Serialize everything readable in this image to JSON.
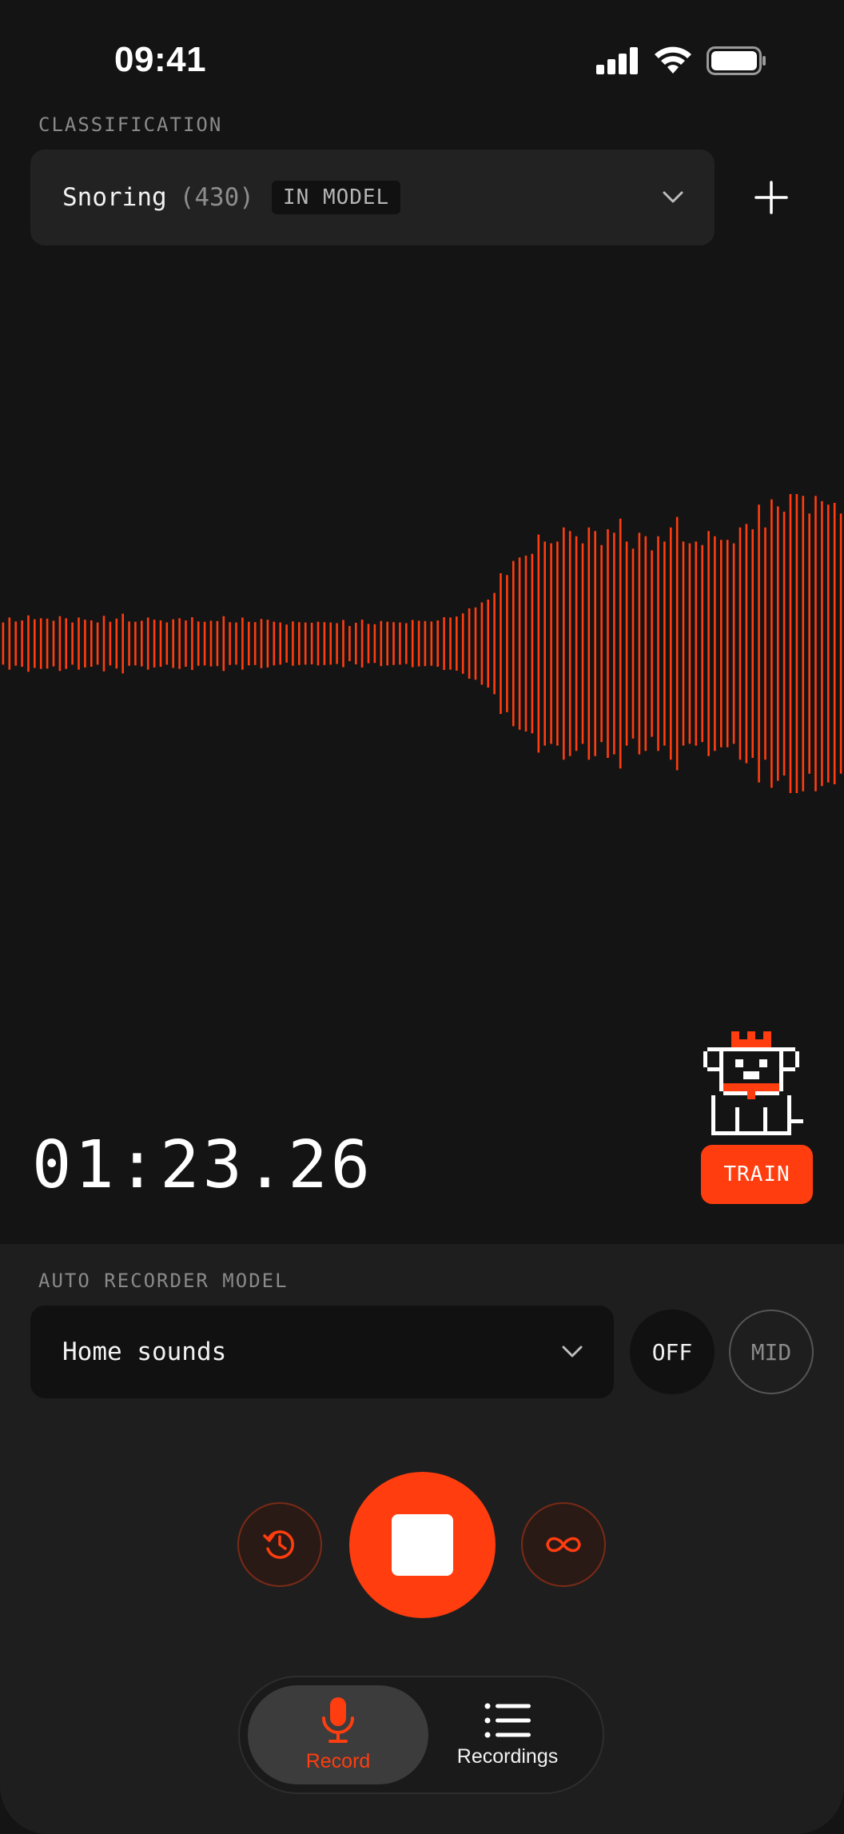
{
  "status_bar": {
    "time": "09:41"
  },
  "classification": {
    "label": "CLASSIFICATION",
    "name": "Snoring",
    "count": "(430)",
    "badge": "IN MODEL"
  },
  "timer": "01:23.26",
  "train_label": "TRAIN",
  "auto_recorder": {
    "label": "AUTO RECORDER MODEL",
    "model": "Home sounds",
    "toggle_off": "OFF",
    "toggle_mid": "MID"
  },
  "tabs": [
    {
      "label": "Record",
      "icon": "microphone-icon",
      "active": true
    },
    {
      "label": "Recordings",
      "icon": "list-icon",
      "active": false
    }
  ],
  "colors": {
    "accent": "#ff3d0f",
    "background": "#141415",
    "panel": "#1e1e1f"
  },
  "waveform_amplitudes": [
    0.12,
    0.14,
    0.11,
    0.13,
    0.15,
    0.12,
    0.14,
    0.13,
    0.11,
    0.15,
    0.13,
    0.12,
    0.14,
    0.12,
    0.13,
    0.11,
    0.14,
    0.12,
    0.13,
    0.15,
    0.12,
    0.11,
    0.13,
    0.14,
    0.12,
    0.13,
    0.11,
    0.12,
    0.14,
    0.12,
    0.13,
    0.12,
    0.11,
    0.13,
    0.12,
    0.14,
    0.12,
    0.11,
    0.13,
    0.12,
    0.11,
    0.12,
    0.13,
    0.11,
    0.12,
    0.1,
    0.11,
    0.12,
    0.11,
    0.1,
    0.12,
    0.11,
    0.1,
    0.11,
    0.12,
    0.1,
    0.11,
    0.12,
    0.11,
    0.1,
    0.11,
    0.12,
    0.11,
    0.1,
    0.11,
    0.12,
    0.13,
    0.12,
    0.11,
    0.13,
    0.14,
    0.13,
    0.15,
    0.16,
    0.18,
    0.2,
    0.22,
    0.25,
    0.28,
    0.32,
    0.38,
    0.42,
    0.4,
    0.48,
    0.45,
    0.52,
    0.55,
    0.5,
    0.58,
    0.62,
    0.56,
    0.6,
    0.52,
    0.57,
    0.62,
    0.5,
    0.55,
    0.6,
    0.64,
    0.58,
    0.5,
    0.55,
    0.6,
    0.48,
    0.52,
    0.56,
    0.6,
    0.62,
    0.55,
    0.5,
    0.58,
    0.52,
    0.56,
    0.6,
    0.54,
    0.5,
    0.55,
    0.6,
    0.58,
    0.62,
    0.72,
    0.66,
    0.78,
    0.7,
    0.74,
    0.8,
    0.76,
    0.82,
    0.68,
    0.74,
    0.78,
    0.72,
    0.8,
    0.7
  ]
}
